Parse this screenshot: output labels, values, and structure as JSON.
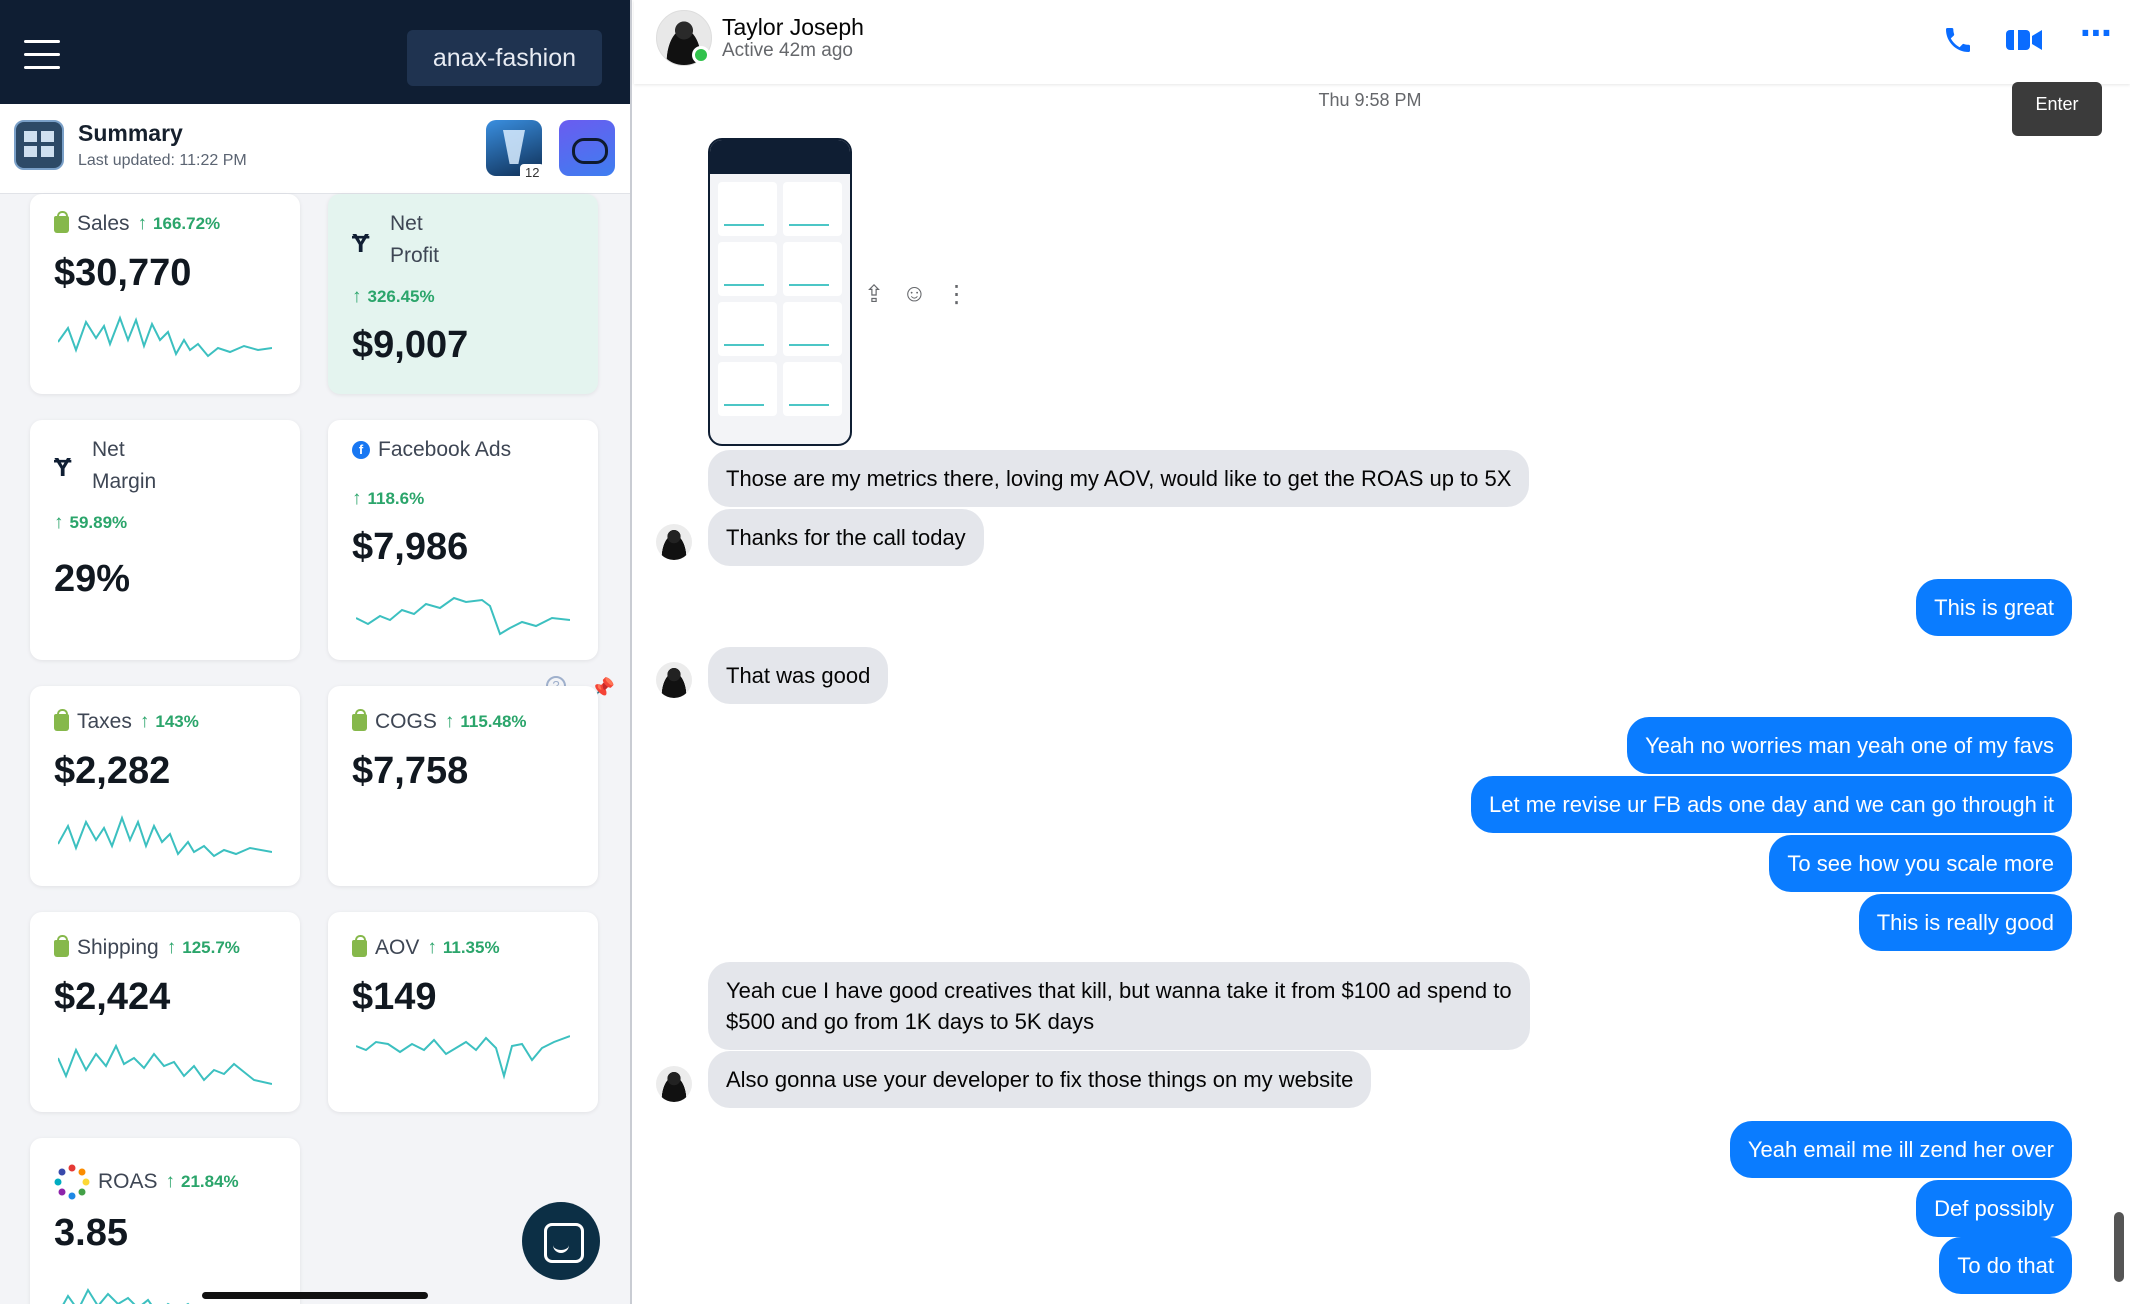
{
  "left_panel": {
    "store_name": "anax-fashion",
    "summary_title": "Summary",
    "summary_updated": "Last updated: 11:22 PM",
    "app_badge": "12",
    "metrics": [
      {
        "label": "Sales",
        "change": "166.72%",
        "value": "$30,770",
        "icon": "shopify-bag-icon"
      },
      {
        "label_line1": "Net",
        "label_line2": "Profit",
        "change": "326.45%",
        "value": "$9,007",
        "icon": "triple-whale-icon"
      },
      {
        "label_line1": "Net",
        "label_line2": "Margin",
        "change": "59.89%",
        "value": "29%",
        "icon": "triple-whale-icon"
      },
      {
        "label": "Facebook Ads",
        "change": "118.6%",
        "value": "$7,986",
        "icon": "facebook-icon"
      },
      {
        "label": "Taxes",
        "change": "143%",
        "value": "$2,282",
        "icon": "shopify-bag-icon"
      },
      {
        "label": "COGS",
        "change": "115.48%",
        "value": "$7,758",
        "icon": "shopify-bag-icon"
      },
      {
        "label": "Shipping",
        "change": "125.7%",
        "value": "$2,424",
        "icon": "shopify-bag-icon"
      },
      {
        "label": "AOV",
        "change": "11.35%",
        "value": "$149",
        "icon": "shopify-bag-icon"
      },
      {
        "label": "ROAS",
        "change": "21.84%",
        "value": "3.85",
        "icon": "multicolor-dots-icon"
      }
    ],
    "colors": {
      "topbar": "#0f1e33",
      "positive": "#2ba56b",
      "spark": "#3cc0c0",
      "highlight_card": "#e4f4ef"
    }
  },
  "chat": {
    "contact_name": "Taylor Joseph",
    "contact_status": "Active 42m ago",
    "timestamp": "Thu 9:58 PM",
    "enter_tooltip": "Enter",
    "messages": [
      {
        "dir": "in",
        "text": "Those are my metrics there, loving my AOV, would like to get the ROAS up to 5X"
      },
      {
        "dir": "in",
        "text": "Thanks for the call today"
      },
      {
        "dir": "out",
        "text": "This is great"
      },
      {
        "dir": "in",
        "text": "That was good"
      },
      {
        "dir": "out",
        "text": "Yeah no worries man yeah one of my favs"
      },
      {
        "dir": "out",
        "text": "Let me revise ur FB ads one day and we can go through it"
      },
      {
        "dir": "out",
        "text": "To see how you scale more"
      },
      {
        "dir": "out",
        "text": "This is really good"
      },
      {
        "dir": "in",
        "text": "Yeah cue I have good creatives that kill, but wanna take it from $100 ad spend to\n$500 and go from 1K days to 5K days"
      },
      {
        "dir": "in",
        "text": "Also gonna use your developer to fix those things on my website"
      },
      {
        "dir": "out",
        "text": "Yeah email me ill zend her over"
      },
      {
        "dir": "out",
        "text": "Def possibly"
      },
      {
        "dir": "out",
        "text": "To do that"
      }
    ],
    "colors": {
      "outgoing": "#0a7cff",
      "incoming": "#e4e6eb",
      "accent": "#0a6cff"
    }
  }
}
